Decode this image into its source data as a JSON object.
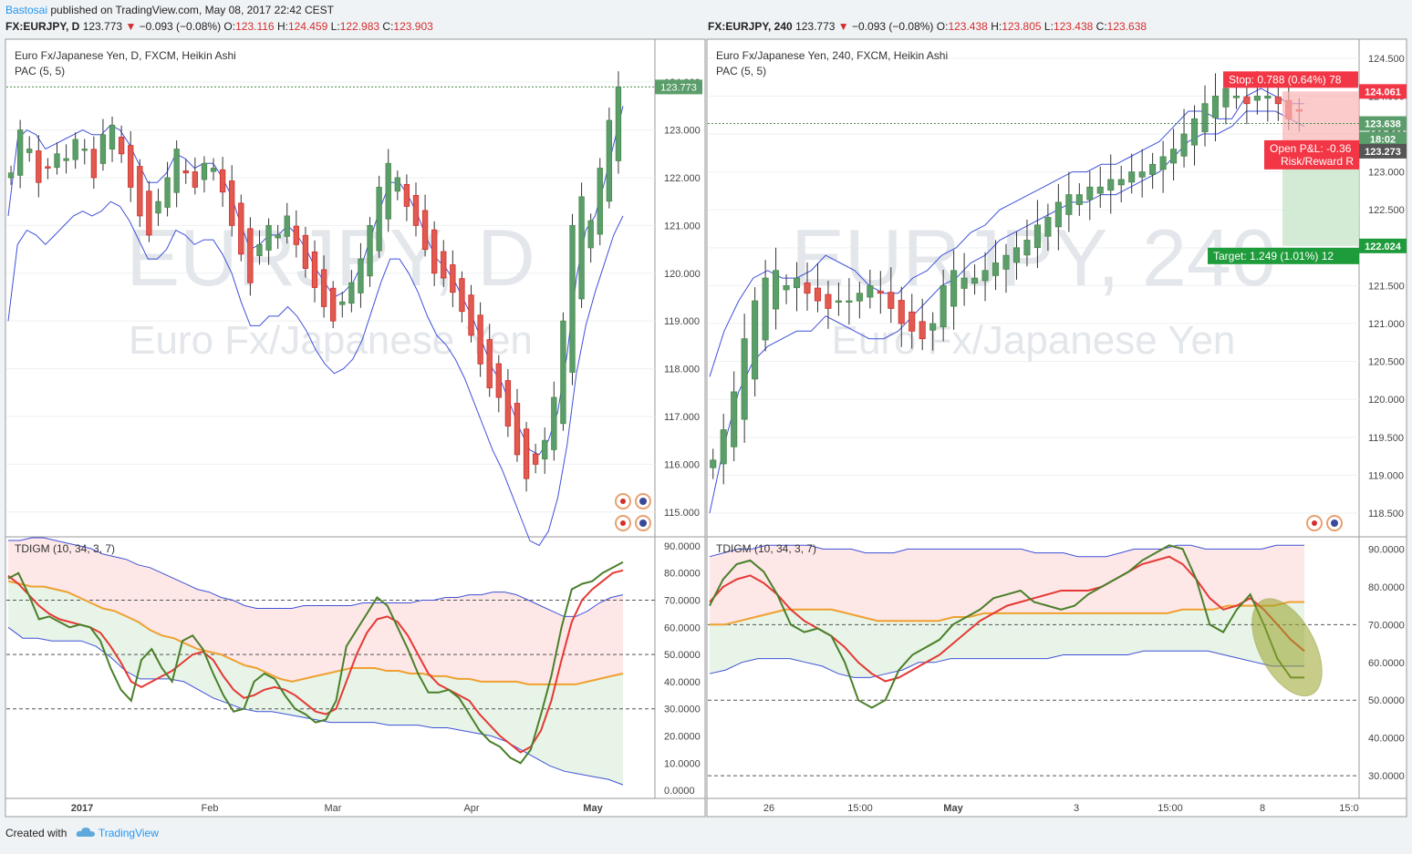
{
  "header": {
    "author": "Bastosai",
    "published_text": "published on TradingView.com, May 08, 2017 22:42 CEST",
    "footer_created": "Created with",
    "footer_brand": "TradingView"
  },
  "left_panel": {
    "symbol_line": {
      "sym": "FX:EURJPY, D",
      "price": "123.773",
      "change": "−0.093 (−0.08%)",
      "O": "123.116",
      "H": "124.459",
      "L": "122.983",
      "C": "123.903"
    },
    "title": "Euro Fx/Japanese Yen, D, FXCM, Heikin Ashi",
    "indicator": "PAC (5, 5)",
    "watermark_main": "EURJPY, D",
    "watermark_sub": "Euro Fx/Japanese Yen",
    "osc_label": "TDIGM (10, 34, 3, 7)",
    "last_price_label": "123.773",
    "time_labels": [
      "2017",
      "Feb",
      "Mar",
      "Apr",
      "May"
    ]
  },
  "right_panel": {
    "symbol_line": {
      "sym": "FX:EURJPY, 240",
      "price": "123.773",
      "change": "−0.093 (−0.08%)",
      "O": "123.438",
      "H": "123.805",
      "L": "123.438",
      "C": "123.638"
    },
    "title": "Euro Fx/Japanese Yen, 240, FXCM, Heikin Ashi",
    "indicator": "PAC (5, 5)",
    "watermark_main": "EURJPY, 240",
    "watermark_sub": "Euro Fx/Japanese Yen",
    "osc_label": "TDIGM (10, 34, 3, 7)",
    "stop_label": "Stop: 0.788 (0.64%) 78",
    "target_label": "Target: 1.249 (1.01%) 12",
    "pnl_label": "Open P&L: -0.36",
    "rr_label": "Risk/Reward R",
    "price_labels": {
      "stop": "124.061",
      "last": "123.638",
      "countdown": "18:02",
      "entry": "123.273",
      "target": "122.024"
    },
    "time_labels": [
      "26",
      "15:00",
      "May",
      "3",
      "15:00",
      "8",
      "15:0"
    ]
  },
  "chart_data": [
    {
      "type": "candlestick",
      "title": "Euro Fx/Japanese Yen, D, FXCM, Heikin Ashi",
      "ylim": [
        114.5,
        124.9
      ],
      "yticks": [
        "124.000",
        "123.000",
        "122.000",
        "121.000",
        "120.000",
        "119.000",
        "118.000",
        "117.000",
        "116.000",
        "115.000"
      ],
      "closes": [
        122.1,
        123.0,
        122.6,
        121.9,
        122.2,
        122.5,
        122.4,
        122.8,
        122.6,
        122.0,
        122.9,
        123.1,
        122.5,
        121.8,
        121.2,
        120.8,
        121.5,
        122.0,
        122.6,
        122.1,
        121.8,
        122.3,
        122.2,
        121.7,
        121.0,
        120.4,
        119.8,
        120.6,
        121.0,
        120.8,
        121.2,
        120.6,
        120.1,
        119.7,
        119.3,
        119.0,
        119.4,
        119.8,
        120.3,
        121.0,
        121.8,
        122.3,
        122.0,
        121.4,
        121.0,
        120.5,
        120.0,
        119.9,
        119.6,
        119.2,
        118.7,
        118.1,
        117.6,
        117.4,
        116.8,
        116.2,
        115.7,
        116.0,
        116.5,
        117.4,
        119.0,
        121.0,
        121.6,
        121.1,
        122.2,
        123.2,
        123.9
      ],
      "pac_upper": [
        121.2,
        122.8,
        123.0,
        122.9,
        122.6,
        122.7,
        122.8,
        122.9,
        123.0,
        122.9,
        122.9,
        123.1,
        123.0,
        122.7,
        122.3,
        121.9,
        121.9,
        122.1,
        122.5,
        122.4,
        122.2,
        122.3,
        122.3,
        122.0,
        121.6,
        121.0,
        120.5,
        120.6,
        120.8,
        120.8,
        121.0,
        120.8,
        120.5,
        120.1,
        119.8,
        119.5,
        119.6,
        119.8,
        120.2,
        120.8,
        121.4,
        121.9,
        121.9,
        121.6,
        121.2,
        120.7,
        120.3,
        120.1,
        119.8,
        119.4,
        119.0,
        118.5,
        118.0,
        117.7,
        117.2,
        116.7,
        116.3,
        116.2,
        116.5,
        117.1,
        118.3,
        119.9,
        120.9,
        121.2,
        121.9,
        122.7,
        123.5
      ],
      "pac_lower": [
        119.0,
        120.6,
        120.9,
        120.8,
        120.6,
        120.8,
        121.0,
        121.2,
        121.3,
        121.2,
        121.3,
        121.5,
        121.4,
        121.1,
        120.7,
        120.3,
        120.3,
        120.5,
        120.9,
        120.8,
        120.6,
        120.7,
        120.7,
        120.4,
        120.0,
        119.4,
        118.9,
        118.9,
        119.1,
        119.1,
        119.3,
        119.1,
        118.8,
        118.4,
        118.1,
        117.9,
        118.0,
        118.2,
        118.6,
        119.2,
        119.8,
        120.3,
        120.3,
        120.0,
        119.6,
        119.1,
        118.7,
        118.5,
        118.2,
        117.8,
        117.3,
        116.8,
        116.3,
        115.9,
        115.4,
        114.9,
        114.4,
        114.3,
        114.6,
        115.3,
        116.4,
        117.9,
        118.9,
        119.6,
        120.2,
        120.8,
        121.2
      ],
      "osc_ylim": [
        -3,
        93
      ],
      "osc_yticks": [
        "90.0000",
        "80.0000",
        "70.0000",
        "60.0000",
        "50.0000",
        "40.0000",
        "30.0000",
        "20.0000",
        "10.0000",
        "0.0000"
      ],
      "osc_green": [
        78,
        80,
        72,
        63,
        64,
        62,
        60,
        61,
        60,
        55,
        45,
        37,
        33,
        48,
        52,
        45,
        40,
        55,
        57,
        52,
        43,
        35,
        29,
        30,
        40,
        43,
        41,
        35,
        30,
        28,
        25,
        26,
        33,
        53,
        59,
        65,
        71,
        68,
        60,
        52,
        43,
        36,
        36,
        37,
        34,
        28,
        22,
        18,
        16,
        12,
        10,
        15,
        28,
        42,
        60,
        74,
        76,
        77,
        80,
        82,
        84
      ],
      "osc_red": [
        79,
        76,
        72,
        68,
        65,
        63,
        62,
        61,
        60,
        58,
        53,
        47,
        40,
        38,
        40,
        42,
        44,
        47,
        50,
        51,
        48,
        42,
        37,
        34,
        35,
        37,
        38,
        37,
        35,
        32,
        29,
        28,
        30,
        40,
        50,
        58,
        63,
        64,
        62,
        57,
        50,
        43,
        39,
        37,
        35,
        33,
        28,
        24,
        20,
        17,
        14,
        16,
        22,
        33,
        48,
        62,
        70,
        74,
        77,
        80,
        81
      ],
      "osc_mid": [
        77,
        76,
        75,
        75,
        74,
        73,
        71,
        69,
        67,
        66,
        64,
        62,
        59,
        57,
        56,
        54,
        52,
        51,
        50,
        48,
        46,
        45,
        43,
        41,
        40,
        41,
        42,
        43,
        44,
        45,
        45,
        45,
        44,
        44,
        43,
        43,
        42,
        42,
        41,
        41,
        40,
        40,
        40,
        40,
        39,
        39,
        39,
        39,
        39,
        40,
        41,
        42,
        43
      ],
      "osc_upper": [
        92,
        92,
        93,
        93,
        92,
        91,
        90,
        89,
        87,
        86,
        85,
        83,
        82,
        80,
        78,
        76,
        74,
        73,
        71,
        70,
        68,
        67,
        67,
        67,
        67,
        68,
        68,
        68,
        68,
        68,
        69,
        69,
        69,
        69,
        69,
        70,
        70,
        71,
        71,
        72,
        72,
        73,
        73,
        72,
        70,
        68,
        66,
        64,
        64,
        66,
        69,
        71,
        72
      ],
      "osc_lower": [
        60,
        56,
        56,
        55,
        55,
        55,
        53,
        49,
        44,
        41,
        41,
        41,
        40,
        37,
        34,
        32,
        30,
        29,
        29,
        28,
        27,
        26,
        25,
        25,
        25,
        25,
        24,
        24,
        24,
        23,
        23,
        22,
        21,
        20,
        18,
        15,
        12,
        9,
        7,
        6,
        5,
        4,
        2
      ]
    },
    {
      "type": "candlestick",
      "title": "Euro Fx/Japanese Yen, 240, FXCM, Heikin Ashi",
      "ylim": [
        118.2,
        124.75
      ],
      "yticks": [
        "124.500",
        "124.000",
        "123.500",
        "123.000",
        "122.500",
        "122.000",
        "121.500",
        "121.000",
        "120.500",
        "120.000",
        "119.500",
        "119.000",
        "118.500"
      ],
      "closes": [
        119.2,
        119.6,
        120.1,
        120.8,
        121.3,
        121.6,
        121.7,
        121.5,
        121.6,
        121.4,
        121.3,
        121.2,
        121.3,
        121.3,
        121.4,
        121.5,
        121.4,
        121.2,
        121.0,
        120.9,
        120.8,
        121.0,
        121.5,
        121.7,
        121.6,
        121.6,
        121.7,
        121.8,
        121.9,
        122.0,
        122.1,
        122.3,
        122.4,
        122.6,
        122.7,
        122.7,
        122.8,
        122.8,
        122.9,
        122.9,
        123.0,
        123.0,
        123.1,
        123.2,
        123.3,
        123.5,
        123.7,
        123.9,
        124.0,
        124.1,
        124.0,
        123.9,
        124.0,
        124.0,
        123.9,
        123.7,
        123.8
      ],
      "pac_upper": [
        120.3,
        120.9,
        121.3,
        121.6,
        121.7,
        121.6,
        121.6,
        121.7,
        121.9,
        121.8,
        121.7,
        121.5,
        121.4,
        121.4,
        121.6,
        121.7,
        121.9,
        122.0,
        122.2,
        122.3,
        122.5,
        122.6,
        122.7,
        122.8,
        122.9,
        123.0,
        123.0,
        123.1,
        123.1,
        123.2,
        123.3,
        123.4,
        123.6,
        123.8,
        123.8,
        123.7,
        123.7,
        124.0,
        124.1,
        124.0,
        123.9,
        123.9
      ],
      "pac_lower": [
        118.5,
        119.4,
        120.1,
        120.5,
        120.7,
        120.8,
        120.9,
        120.9,
        121.1,
        121.0,
        120.9,
        120.8,
        120.8,
        120.9,
        121.1,
        121.3,
        121.5,
        121.6,
        121.8,
        121.9,
        122.1,
        122.2,
        122.3,
        122.4,
        122.5,
        122.6,
        122.6,
        122.7,
        122.7,
        122.8,
        122.9,
        123.0,
        123.2,
        123.4,
        123.5,
        123.5,
        123.6,
        123.8,
        123.8,
        123.8,
        123.7,
        123.6
      ],
      "position": {
        "entry": 123.273,
        "stop": 124.061,
        "target": 122.024,
        "last": 123.638
      },
      "osc_ylim": [
        24,
        93
      ],
      "osc_yticks": [
        "90.0000",
        "80.0000",
        "70.0000",
        "60.0000",
        "50.0000",
        "40.0000",
        "30.0000"
      ],
      "osc_green": [
        75,
        82,
        86,
        87,
        84,
        78,
        70,
        68,
        69,
        67,
        60,
        50,
        48,
        50,
        58,
        62,
        64,
        66,
        70,
        72,
        74,
        77,
        78,
        79,
        76,
        75,
        74,
        75,
        78,
        80,
        82,
        84,
        87,
        89,
        91,
        90,
        82,
        70,
        68,
        74,
        78,
        70,
        61,
        56,
        56
      ],
      "osc_red": [
        76,
        80,
        82,
        83,
        81,
        78,
        74,
        71,
        69,
        67,
        64,
        60,
        57,
        55,
        56,
        58,
        60,
        62,
        65,
        68,
        71,
        73,
        75,
        76,
        77,
        78,
        79,
        79,
        79,
        80,
        82,
        84,
        86,
        87,
        88,
        86,
        82,
        77,
        74,
        75,
        77,
        74,
        70,
        66,
        63
      ],
      "osc_mid": [
        70,
        70,
        71,
        72,
        73,
        74,
        74,
        74,
        74,
        73,
        72,
        71,
        71,
        71,
        71,
        71,
        72,
        72,
        73,
        73,
        73,
        73,
        73,
        73,
        73,
        73,
        73,
        73,
        73,
        73,
        73,
        74,
        74,
        74,
        75,
        75,
        75,
        75,
        76,
        76
      ],
      "osc_upper": [
        88,
        89,
        90,
        90,
        91,
        91,
        91,
        91,
        90,
        90,
        90,
        89,
        89,
        89,
        90,
        90,
        90,
        90,
        90,
        90,
        90,
        90,
        90,
        89,
        89,
        89,
        88,
        88,
        88,
        89,
        90,
        90,
        90,
        91,
        91,
        90,
        90,
        90,
        90,
        90,
        91,
        91,
        91
      ],
      "osc_lower": [
        57,
        58,
        60,
        61,
        61,
        61,
        60,
        59,
        57,
        56,
        56,
        57,
        58,
        60,
        60,
        61,
        61,
        61,
        61,
        61,
        61,
        61,
        62,
        62,
        62,
        62,
        62,
        63,
        63,
        63,
        63,
        63,
        62,
        61,
        60,
        59,
        59,
        59
      ]
    }
  ]
}
